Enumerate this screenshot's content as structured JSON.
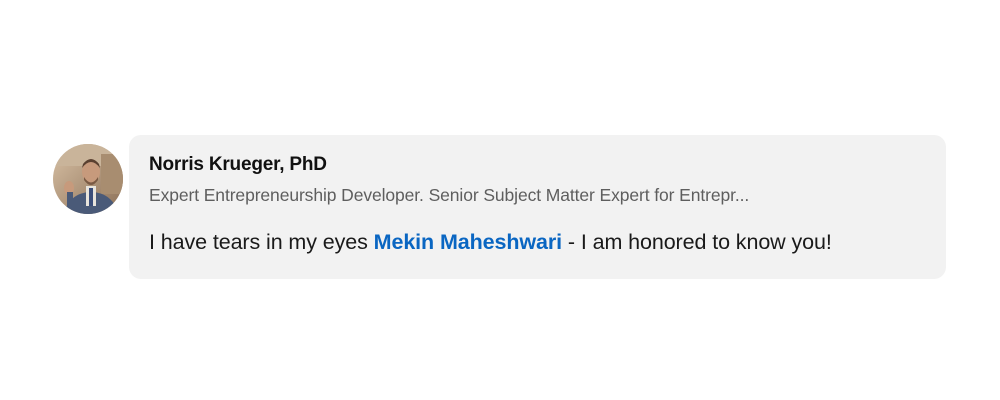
{
  "comment": {
    "author_name": "Norris Krueger, PhD",
    "author_headline": "Expert Entrepreneurship Developer. Senior Subject Matter Expert for Entrepr...",
    "text_before": "I have tears in my eyes ",
    "mention": "Mekin Maheshwari",
    "text_after": " - I am honored to know you!",
    "avatar_icon": "profile-photo-icon"
  },
  "colors": {
    "bubble_background": "#f2f2f2",
    "mention": "#0a66c2",
    "name": "#111111",
    "headline": "#5e5e5e",
    "body_text": "#1a1a1a"
  }
}
